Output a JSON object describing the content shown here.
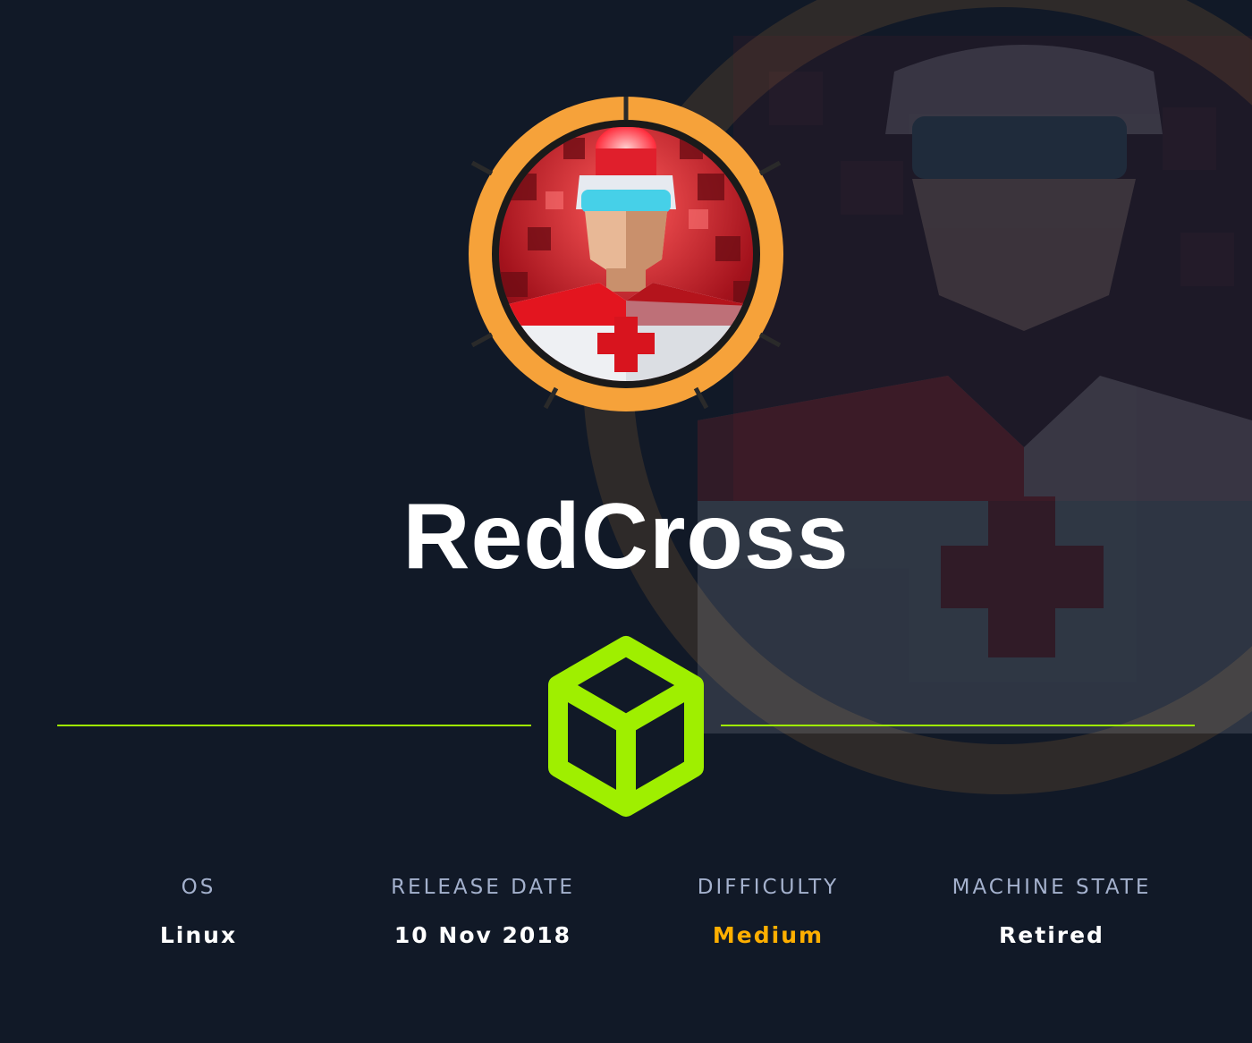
{
  "machine": {
    "name": "RedCross"
  },
  "info": {
    "os_label": "OS",
    "os_value": "Linux",
    "release_label": "RELEASE DATE",
    "release_value": "10 Nov 2018",
    "difficulty_label": "DIFFICULTY",
    "difficulty_value": "Medium",
    "state_label": "MACHINE STATE",
    "state_value": "Retired"
  },
  "colors": {
    "background": "#111927",
    "accent_green": "#9fef00",
    "difficulty_medium": "#ffaf00",
    "label_gray": "#a4b1cd",
    "ring_orange": "#f6a23a"
  },
  "icons": {
    "avatar": "redcross-medic-avatar",
    "cube": "cube-icon"
  }
}
